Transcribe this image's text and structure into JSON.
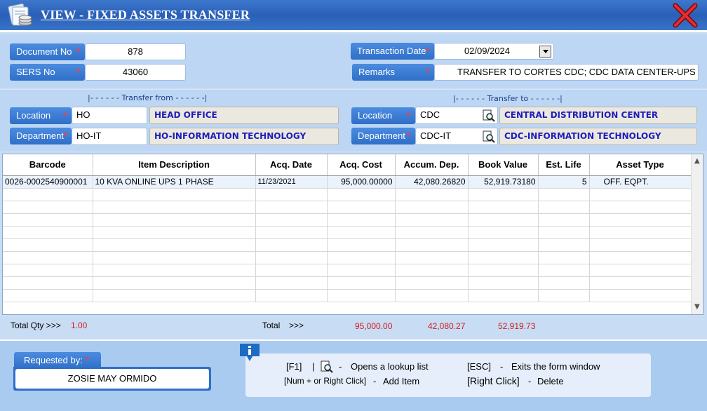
{
  "window": {
    "title": "VIEW - FIXED ASSETS TRANSFER",
    "close_icon": "close-x-icon"
  },
  "header": {
    "document_no_label": "Document No",
    "document_no": "878",
    "sers_no_label": "SERS No",
    "sers_no": "43060",
    "transaction_date_label": "Transaction Date",
    "transaction_date": "02/09/2024",
    "remarks_label": "Remarks",
    "remarks": "TRANSFER TO CORTES CDC; CDC DATA CENTER-UPS ROC",
    "required_mark": "*"
  },
  "transfer_from": {
    "heading": "|- - - - - - Transfer from - - - - - -|",
    "location_label": "Location",
    "location_code": "HO",
    "location_name": "HEAD OFFICE",
    "department_label": "Department",
    "department_code": "HO-IT",
    "department_name": "HO-INFORMATION TECHNOLOGY"
  },
  "transfer_to": {
    "heading": "|- - - - - - Transfer to - - - - - -|",
    "location_label": "Location",
    "location_code": "CDC",
    "location_name": "CENTRAL DISTRIBUTION CENTER",
    "department_label": "Department",
    "department_code": "CDC-IT",
    "department_name": "CDC-INFORMATION TECHNOLOGY"
  },
  "grid": {
    "columns": [
      "Barcode",
      "Item Description",
      "Acq. Date",
      "Acq. Cost",
      "Accum. Dep.",
      "Book Value",
      "Est. Life",
      "Asset Type"
    ],
    "rows": [
      [
        "0026-0002540900001",
        "10 KVA ONLINE UPS 1 PHASE",
        "11/23/2021",
        "95,000.00000",
        "42,080.26820",
        "52,919.73180",
        "5",
        "OFF. EQPT."
      ]
    ]
  },
  "totals": {
    "qty_label": "Total Qty  >>>",
    "qty": "1.00",
    "total_label": "Total",
    "arrows": ">>>",
    "acq_cost": "95,000.00",
    "accum_dep": "42,080.27",
    "book_value": "52,919.73"
  },
  "requested_by": {
    "label": "Requested by:",
    "required_mark": "*",
    "value": "ZOSIE MAY ORMIDO"
  },
  "help": {
    "f1_key": "[F1]",
    "separator": "|",
    "dash": "-",
    "f1_text": "Opens a lookup list",
    "esc_key": "[ESC]",
    "esc_text": "Exits the form window",
    "add_key": "[Num + or Right Click]",
    "add_text": "Add Item",
    "del_key": "[Right Click]",
    "del_text": "Delete"
  },
  "colors": {
    "title_bar": "#2a5fb7",
    "label_blue": "#2f6fc8",
    "required_red": "#ff3b3b",
    "readonly_text": "#1d1dbd",
    "total_red": "#d21e1e"
  }
}
